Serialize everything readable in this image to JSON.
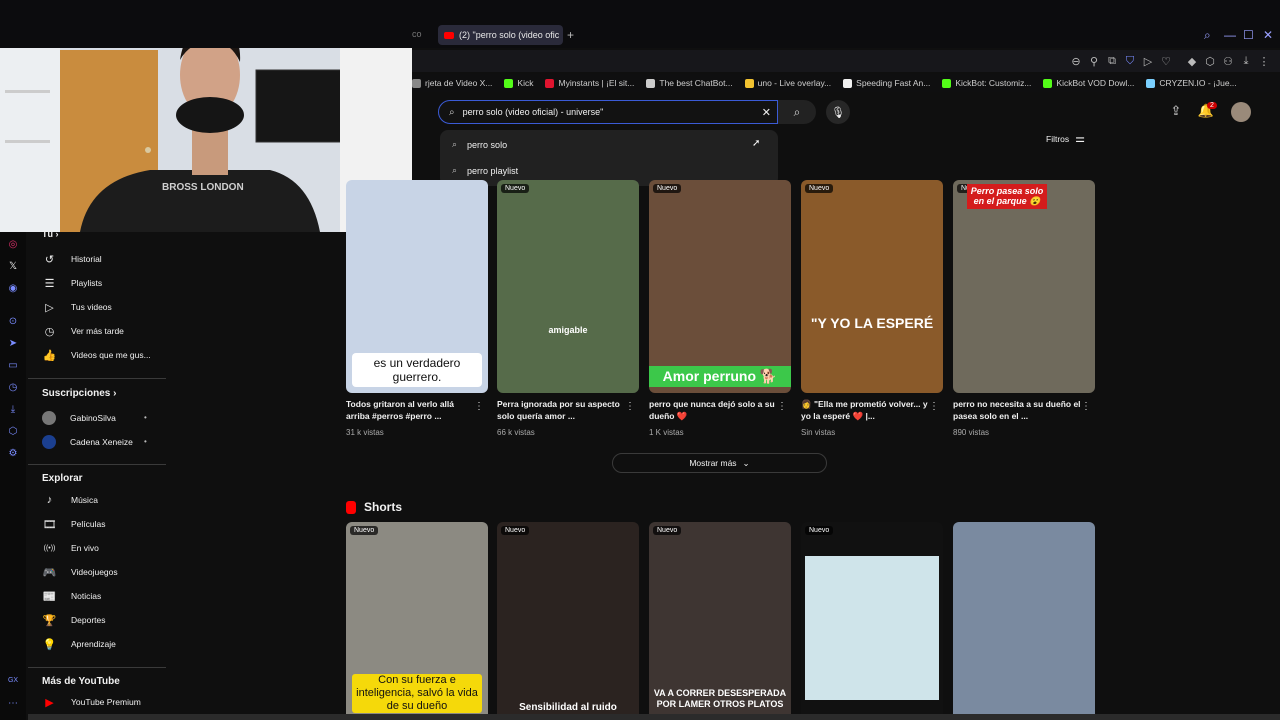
{
  "browser": {
    "active_tab": "(2) \"perro solo (video ofic",
    "partial_tab": "co",
    "new_tab": "+",
    "bookmarks": [
      {
        "label": "rjeta de Video X...",
        "color": "#888888"
      },
      {
        "label": "Kick",
        "color": "#53fc18"
      },
      {
        "label": "Myinstants | ¡El sit...",
        "color": "#e0142f"
      },
      {
        "label": "The best ChatBot...",
        "color": "#cccccc"
      },
      {
        "label": "uno - Live overlay...",
        "color": "#f2c230"
      },
      {
        "label": "Speeding Fast An...",
        "color": "#f0f0f0"
      },
      {
        "label": "KickBot: Customiz...",
        "color": "#53fc18"
      },
      {
        "label": "KickBot VOD Dowl...",
        "color": "#53fc18"
      },
      {
        "label": "CRYZEN.IO - ¡Jue...",
        "color": "#7ad0ff"
      }
    ]
  },
  "search": {
    "query": "perro solo (video oficial) - universe\"",
    "suggestions": [
      "perro solo",
      "perro playlist"
    ]
  },
  "header": {
    "notifications": "2",
    "filters_label": "Filtros"
  },
  "sidebar": {
    "you_label": "Tú",
    "you_items": [
      {
        "label": "Historial",
        "icon": "history-icon",
        "glyph": "↺"
      },
      {
        "label": "Playlists",
        "icon": "playlists-icon",
        "glyph": "☰"
      },
      {
        "label": "Tus videos",
        "icon": "your-videos-icon",
        "glyph": "▷"
      },
      {
        "label": "Ver más tarde",
        "icon": "watch-later-icon",
        "glyph": "◷"
      },
      {
        "label": "Videos que me gus...",
        "icon": "liked-icon",
        "glyph": "👍"
      }
    ],
    "subs_label": "Suscripciones",
    "subs": [
      {
        "label": "GabinoSilva",
        "color": "#777777"
      },
      {
        "label": "Cadena Xeneize",
        "color": "#1b3f8f"
      }
    ],
    "explore_label": "Explorar",
    "explore_items": [
      {
        "label": "Música",
        "icon": "music-icon",
        "glyph": "♪"
      },
      {
        "label": "Películas",
        "icon": "movies-icon",
        "glyph": "🎞"
      },
      {
        "label": "En vivo",
        "icon": "live-icon",
        "glyph": "((•))"
      },
      {
        "label": "Videojuegos",
        "icon": "gaming-icon",
        "glyph": "🎮"
      },
      {
        "label": "Noticias",
        "icon": "news-icon",
        "glyph": "📰"
      },
      {
        "label": "Deportes",
        "icon": "sports-icon",
        "glyph": "🏆"
      },
      {
        "label": "Aprendizaje",
        "icon": "learning-icon",
        "glyph": "💡"
      }
    ],
    "more_label": "Más de YouTube",
    "premium_label": "YouTube Premium"
  },
  "videos": [
    {
      "title": "Todos gritaron al verlo allá arriba #perros #perro ...",
      "views": "31 k vistas",
      "badge": "",
      "caption": "es un verdadero guerrero.",
      "bg": "#c8d4e6",
      "capcolor": "#0f0f0f",
      "capbg": "#ffffff"
    },
    {
      "title": "Perra ignorada por su aspecto solo quería amor ...",
      "views": "66 k vistas",
      "badge": "Nuevo",
      "caption": "amigable",
      "bg": "#566b4a",
      "capcolor": "#ffffff",
      "capbg": "transparent"
    },
    {
      "title": "perro que nunca dejó solo a su dueño ❤️",
      "views": "1 K vistas",
      "badge": "Nuevo",
      "caption": "Amor perruno 🐕",
      "bg": "#6b4e3a",
      "capcolor": "#ffffff",
      "capbg": "#3cc84a"
    },
    {
      "title": "👩 \"Ella me prometió volver... y yo la esperé ❤️ |...",
      "views": "Sin vistas",
      "badge": "Nuevo",
      "caption": "\"Y YO LA ESPERÉ",
      "bg": "#8a5a2a",
      "capcolor": "#ffffff",
      "capbg": "transparent"
    },
    {
      "title": "perro no necesita a su dueño el pasea solo en el ...",
      "views": "890 vistas",
      "badge": "Nuevo",
      "caption": "Perro pasea solo en el parque 😮",
      "bg": "#6f6a5c",
      "capcolor": "#ffffff",
      "capbg": "#d41c1c"
    }
  ],
  "more_label": "Mostrar más",
  "shorts_label": "Shorts",
  "shorts": [
    {
      "badge": "Nuevo",
      "caption": "Con su fuerza e inteligencia, salvó la vida de su dueño",
      "bg": "#8c8a82",
      "capbg": "#f5d90a",
      "capcolor": "#111111"
    },
    {
      "badge": "Nuevo",
      "caption": "Sensibilidad al ruido",
      "bg": "#2b2320",
      "capbg": "transparent",
      "capcolor": "#ffffff"
    },
    {
      "badge": "Nuevo",
      "caption": "VA A CORRER DESESPERADA POR LAMER OTROS PLATOS",
      "bg": "#3e3532",
      "capbg": "transparent",
      "capcolor": "#ffffff"
    },
    {
      "badge": "Nuevo",
      "caption": "",
      "bg": "#111111",
      "capbg": "transparent",
      "capcolor": "#ffffff"
    },
    {
      "badge": "",
      "caption": "",
      "bg": "#7a8aa0",
      "capbg": "transparent",
      "capcolor": "#ffffff"
    }
  ]
}
